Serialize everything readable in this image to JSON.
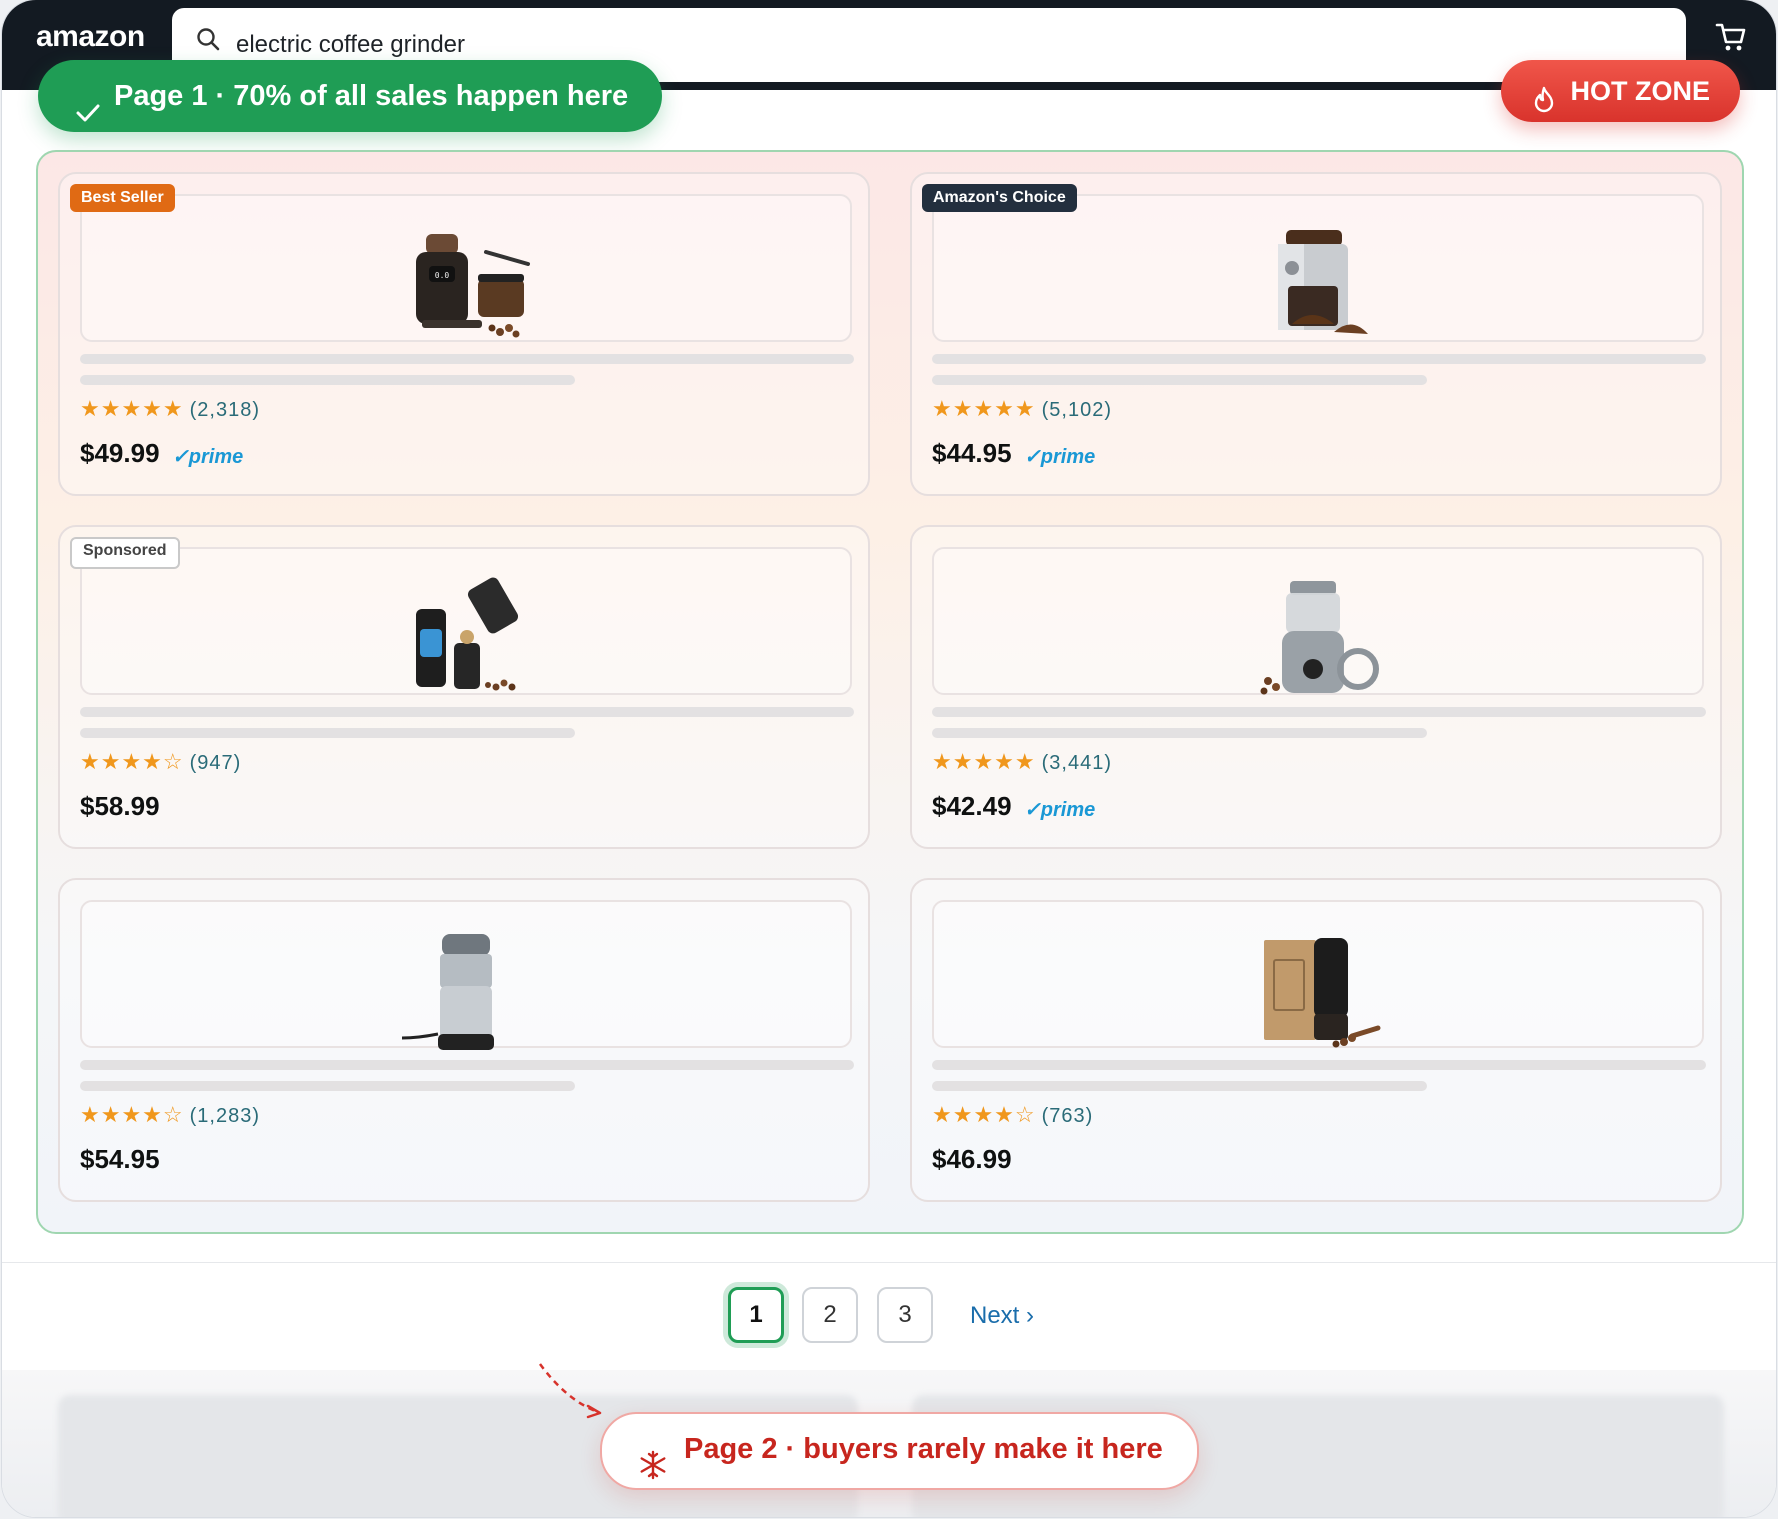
{
  "header": {
    "logo": "amazon",
    "search_query": "electric coffee grinder"
  },
  "callouts": {
    "page1": "Page 1 · 70% of all sales happen here",
    "hot_zone": "HOT ZONE",
    "page2": "Page 2 · buyers rarely make it here"
  },
  "products": [
    {
      "tag": "Best Seller",
      "stars": "★★★★★",
      "count": "(2,318)",
      "price": "$49.99",
      "prime": "✓prime",
      "icon": "burr-grinder-image"
    },
    {
      "tag": "Amazon's Choice",
      "stars": "★★★★★",
      "count": "(5,102)",
      "price": "$44.95",
      "prime": "✓prime",
      "icon": "silver-burr-grinder-image"
    },
    {
      "tag": "Sponsored",
      "stars": "★★★★☆",
      "count": "(947)",
      "price": "$58.99",
      "prime": "",
      "icon": "portable-grinder-image"
    },
    {
      "tag": "",
      "stars": "★★★★★",
      "count": "(3,441)",
      "price": "$42.49",
      "prime": "✓prime",
      "icon": "stainless-blade-grinder-image"
    },
    {
      "tag": "",
      "stars": "★★★★☆",
      "count": "(1,283)",
      "price": "$54.95",
      "prime": "",
      "icon": "hamilton-beach-grinder-image"
    },
    {
      "tag": "",
      "stars": "★★★★☆",
      "count": "(763)",
      "price": "$46.99",
      "prime": "",
      "icon": "black-cordless-grinder-image"
    }
  ],
  "pagination": {
    "pages": [
      "1",
      "2",
      "3"
    ],
    "current": "1",
    "next": "Next ›"
  },
  "colors": {
    "header_bg": "#131a22",
    "page1_green": "#1f9d55",
    "hot_red": "#e0392f",
    "star_orange": "#f0971c",
    "prime_blue": "#1a98d5"
  }
}
